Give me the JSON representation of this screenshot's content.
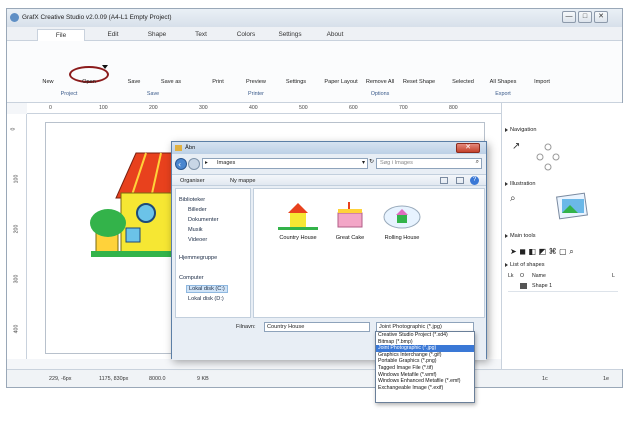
{
  "window": {
    "title": "GrafX Creative Studio v2.0.09 (A4-L1 Empty Project)",
    "controls": [
      "—",
      "□",
      "✕"
    ]
  },
  "tabs": [
    {
      "label": "File",
      "active": true
    },
    {
      "label": "Edit"
    },
    {
      "label": "Shape"
    },
    {
      "label": "Text"
    },
    {
      "label": "Colors"
    },
    {
      "label": "Settings"
    },
    {
      "label": "About"
    }
  ],
  "ribbon": {
    "buttons": [
      "New",
      "Open",
      "Save",
      "Save as",
      "Print",
      "Preview",
      "Settings",
      "Paper Layout",
      "Remove All",
      "Reset Shape",
      "Selected",
      "All Shapes",
      "Import"
    ],
    "groups": [
      "Project",
      "Save",
      "Printer",
      "Options",
      "Export"
    ]
  },
  "ruler": {
    "top": [
      "0",
      "100",
      "200",
      "300",
      "400",
      "500",
      "600",
      "700",
      "800"
    ],
    "left": [
      "0",
      "100",
      "200",
      "300",
      "400"
    ]
  },
  "status": {
    "coords": "229, -6px",
    "size": "1175, 830px",
    "value": "8000.0",
    "memory": "9 KB",
    "right1": "1c",
    "right2": "1e"
  },
  "right_panel": {
    "navigation": "Navigation",
    "illustration": "Illustration",
    "main_tools": "Main tools",
    "list_of_shapes": "List of shapes",
    "columns": [
      "Lk",
      "O",
      "Name",
      "L"
    ],
    "shapes": [
      {
        "name": "Shape 1"
      }
    ]
  },
  "dialog": {
    "title": "Åbn",
    "path": "Images",
    "search_placeholder": "Søg i Images",
    "organise": "Organiser",
    "new_folder": "Ny mappe",
    "nav": [
      "Biblioteker",
      "Billeder",
      "Dokumenter",
      "Musik",
      "Videoer",
      "Hjemmegruppe",
      "Computer",
      "Lokal disk (C:)",
      "Lokal disk (D:)"
    ],
    "files": [
      "Country House",
      "Great Cake",
      "Rolling House"
    ],
    "filename_label": "Filnavn:",
    "filename_value": "Country House",
    "filetype_selected": "Joint Photographic (*.jpg)",
    "filetypes": [
      "Creative Studio Project (*.xd4)",
      "Bitmap (*.bmp)",
      "Joint Photographic (*.jpg)",
      "Graphics Interchange (*.gif)",
      "Portable Graphics (*.png)",
      "Tagged Image File (*.tif)",
      "Windows Metafile (*.wmf)",
      "Windows Enhanced Metafile (*.emf)",
      "Exchangeable Image (*.exif)"
    ]
  },
  "colors": {
    "accent": "#3a78d6",
    "open_highlight": "#8b1b1b",
    "house_roof": "#e8411d",
    "house_wall": "#f6e733",
    "grass": "#33b34a"
  }
}
